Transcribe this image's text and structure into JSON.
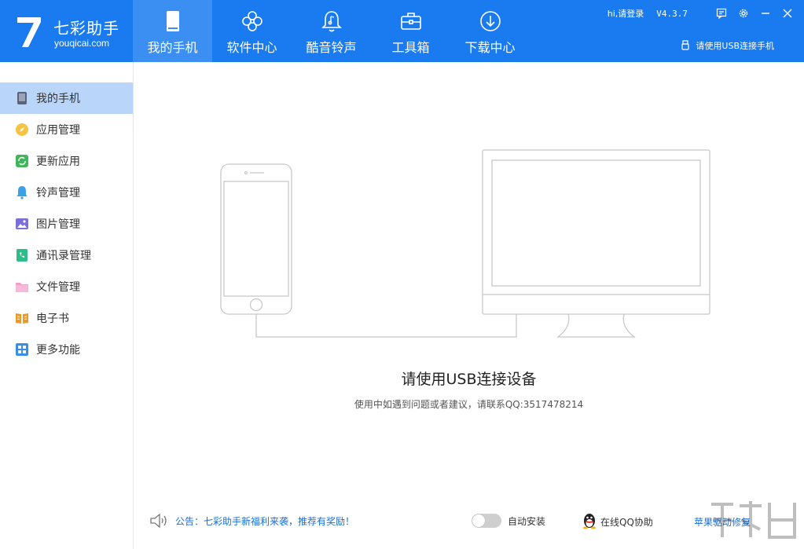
{
  "header": {
    "logo": {
      "mark": "7",
      "name": "七彩助手",
      "url": "youqicai.com"
    },
    "nav": [
      {
        "label": "我的手机",
        "icon": "phone-icon",
        "active": true
      },
      {
        "label": "软件中心",
        "icon": "clover-icon",
        "active": false
      },
      {
        "label": "酷音铃声",
        "icon": "bell-icon",
        "active": false
      },
      {
        "label": "工具箱",
        "icon": "toolbox-icon",
        "active": false
      },
      {
        "label": "下载中心",
        "icon": "download-icon",
        "active": false
      }
    ],
    "login": "hi,请登录",
    "version": "V4.3.7",
    "usb_hint": "请使用USB连接手机"
  },
  "sidebar": {
    "items": [
      {
        "label": "我的手机",
        "icon": "phone-icon",
        "color": "#5a6478",
        "active": true
      },
      {
        "label": "应用管理",
        "icon": "compass-icon",
        "color": "#f5c542",
        "active": false
      },
      {
        "label": "更新应用",
        "icon": "refresh-icon",
        "color": "#3fb65a",
        "active": false
      },
      {
        "label": "铃声管理",
        "icon": "bell-icon",
        "color": "#3aa0e8",
        "active": false
      },
      {
        "label": "图片管理",
        "icon": "image-icon",
        "color": "#7a6fd8",
        "active": false
      },
      {
        "label": "通讯录管理",
        "icon": "contacts-icon",
        "color": "#2ebd8a",
        "active": false
      },
      {
        "label": "文件管理",
        "icon": "folder-icon",
        "color": "#f0a0c8",
        "active": false
      },
      {
        "label": "电子书",
        "icon": "book-icon",
        "color": "#e89a2c",
        "active": false
      },
      {
        "label": "更多功能",
        "icon": "grid-icon",
        "color": "#3a8ee6",
        "active": false
      }
    ]
  },
  "main": {
    "title": "请使用USB连接设备",
    "subtitle": "使用中如遇到问题或者建议，请联系QQ:3517478214"
  },
  "footer": {
    "notice": "公告：七彩助手新福利来袭，推荐有奖励！",
    "auto_install": "自动安装",
    "auto_install_on": false,
    "qq_help": "在线QQ协助",
    "driver_repair": "苹果驱动修复"
  },
  "colors": {
    "brand": "#1a7bf0",
    "active_nav": "#3b8ff2",
    "active_side": "#b9d6fa",
    "link": "#1a6fd6"
  }
}
